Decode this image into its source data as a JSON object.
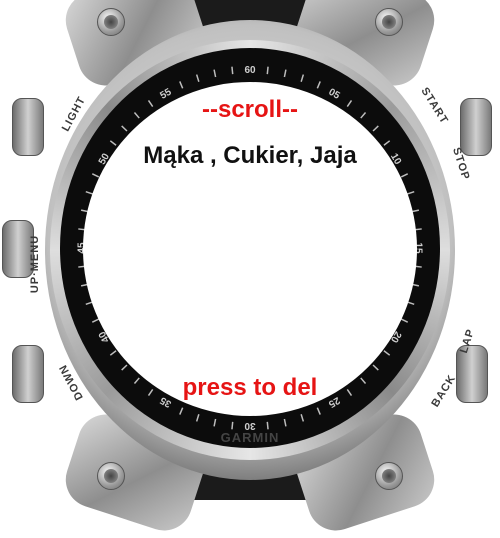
{
  "watch": {
    "brand": "GARMIN",
    "buttons": {
      "light": "LIGHT",
      "up_menu": "UP·MENU",
      "down": "DOWN",
      "start": "START",
      "stop": "STOP",
      "lap": "LAP",
      "back": "BACK"
    },
    "bezel_ticks": [
      "60",
      "05",
      "10",
      "15",
      "20",
      "25",
      "30",
      "35",
      "40",
      "45",
      "50",
      "55"
    ]
  },
  "screen": {
    "header": "--scroll--",
    "item": "Mąka , Cukier, Jaja",
    "action": "press to del"
  },
  "colors": {
    "accent": "#e61414",
    "text": "#111111",
    "screen_bg": "#ffffff",
    "bezel_dark": "#0c0c0c"
  }
}
